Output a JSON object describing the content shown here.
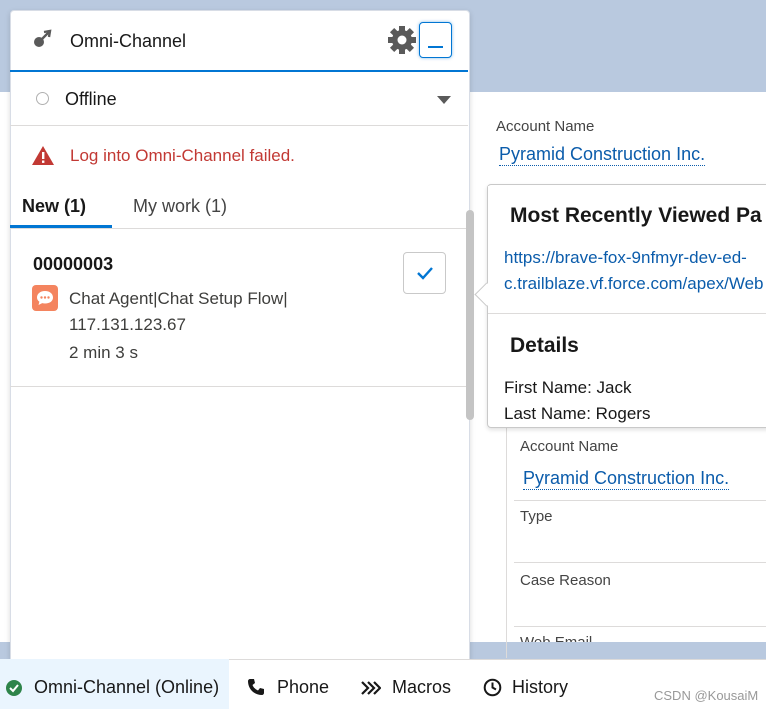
{
  "record": {
    "account_name_label": "Account Name",
    "account_name_value": "Pyramid Construction Inc.",
    "account_name_label_2": "Account Name",
    "account_name_value_2": "Pyramid Construction Inc.",
    "type_label": "Type",
    "case_reason_label": "Case Reason",
    "web_email_label": "Web Email"
  },
  "popover": {
    "title": "Most Recently Viewed Pa",
    "url_line1": "https://brave-fox-9nfmyr-dev-ed-",
    "url_line2": "c.trailblaze.vf.force.com/apex/Web",
    "details_title": "Details",
    "first_name": "First Name: Jack",
    "last_name": "Last Name: Rogers"
  },
  "omni": {
    "title": "Omni-Channel",
    "status": "Offline",
    "error": "Log into Omni-Channel failed.",
    "tabs": [
      {
        "label": "New (1)"
      },
      {
        "label": "My work (1)"
      }
    ],
    "work_item": {
      "id": "00000003",
      "line1": "Chat Agent|Chat Setup Flow|",
      "line2": "117.131.123.67",
      "time": "2 min 3 s"
    }
  },
  "footer": {
    "items": [
      {
        "label": "Omni-Channel (Online)",
        "icon": "check-circle-icon"
      },
      {
        "label": "Phone",
        "icon": "phone-icon"
      },
      {
        "label": "Macros",
        "icon": "macros-icon"
      },
      {
        "label": "History",
        "icon": "history-icon"
      }
    ],
    "watermark": "CSDN @KousaiM"
  },
  "colors": {
    "brand_blue": "#0176d3",
    "error_red": "#c23934",
    "link_blue": "#0b5cab",
    "chat_orange": "#f4845f",
    "success_green": "#2e844a"
  }
}
